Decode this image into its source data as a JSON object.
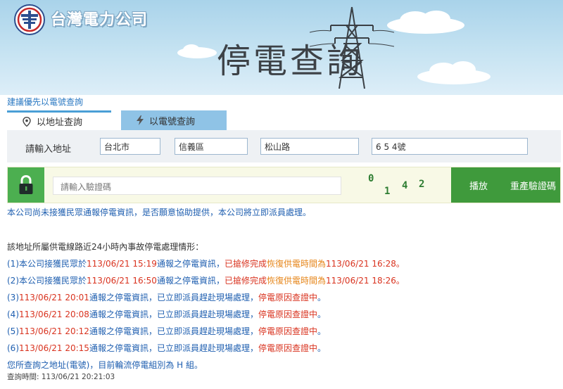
{
  "brand": {
    "name": "台灣電力公司"
  },
  "hero": {
    "title": "停電查詢"
  },
  "hint": "建議優先以電號查詢",
  "tabs": [
    {
      "label": "以地址查詢",
      "icon": "location-pin-icon",
      "active": true
    },
    {
      "label": "以電號查詢",
      "icon": "lightning-icon",
      "active": false
    }
  ],
  "address": {
    "label": "請輸入地址",
    "city": "台北市",
    "district": "信義區",
    "road": "松山路",
    "number": "6 5 4號"
  },
  "captcha": {
    "placeholder": "請輸入驗證碼",
    "digits": [
      "0",
      "1",
      "4",
      "2"
    ],
    "play_label": "播放",
    "regen_label": "重產驗證碼",
    "lock_icon": "lock-icon"
  },
  "colors": {
    "accent_green": "#3f9a3c",
    "link_blue": "#1f5fb0",
    "alert_red": "#d9331f",
    "status_orange": "#e6861a"
  },
  "result": {
    "intro": "本公司尚未接獲民眾通報停電資訊，是否願意協助提供，本公司將立即派員處理。",
    "heading": "該地址所屬供電線路近24小時內事故停電處理情形：",
    "restored": [
      {
        "prefix": "(1)本公司接獲民眾於",
        "time": "113/06/21 15:19",
        "mid": "通報之停電資訊，",
        "status1": "已搶修完成",
        "status2": "恢復供電時間為",
        "restore_time": "113/06/21 16:28",
        "end": "。"
      },
      {
        "prefix": "(2)本公司接獲民眾於",
        "time": "113/06/21 16:50",
        "mid": "通報之停電資訊，",
        "status1": "已搶修完成",
        "status2": "恢復供電時間為",
        "restore_time": "113/06/21 18:26",
        "end": "。"
      }
    ],
    "pending": [
      {
        "num": "(3)",
        "time": "113/06/21 20:01",
        "text": "通報之停電資訊，已立即派員趕赴現場處理，",
        "status": "停電原因查證中",
        "end": "。"
      },
      {
        "num": "(4)",
        "time": "113/06/21 20:08",
        "text": "通報之停電資訊，已立即派員趕赴現場處理，",
        "status": "停電原因查證中",
        "end": "。"
      },
      {
        "num": "(5)",
        "time": "113/06/21 20:12",
        "text": "通報之停電資訊，已立即派員趕赴現場處理，",
        "status": "停電原因查證中",
        "end": "。"
      },
      {
        "num": "(6)",
        "time": "113/06/21 20:15",
        "text": "通報之停電資訊，已立即派員趕赴現場處理，",
        "status": "停電原因查證中",
        "end": "。"
      }
    ],
    "rotation": "您所查詢之地址(電號)，目前輪流停電組別為 H 組。",
    "query_time": "查詢時間: 113/06/21 20:21:03"
  }
}
